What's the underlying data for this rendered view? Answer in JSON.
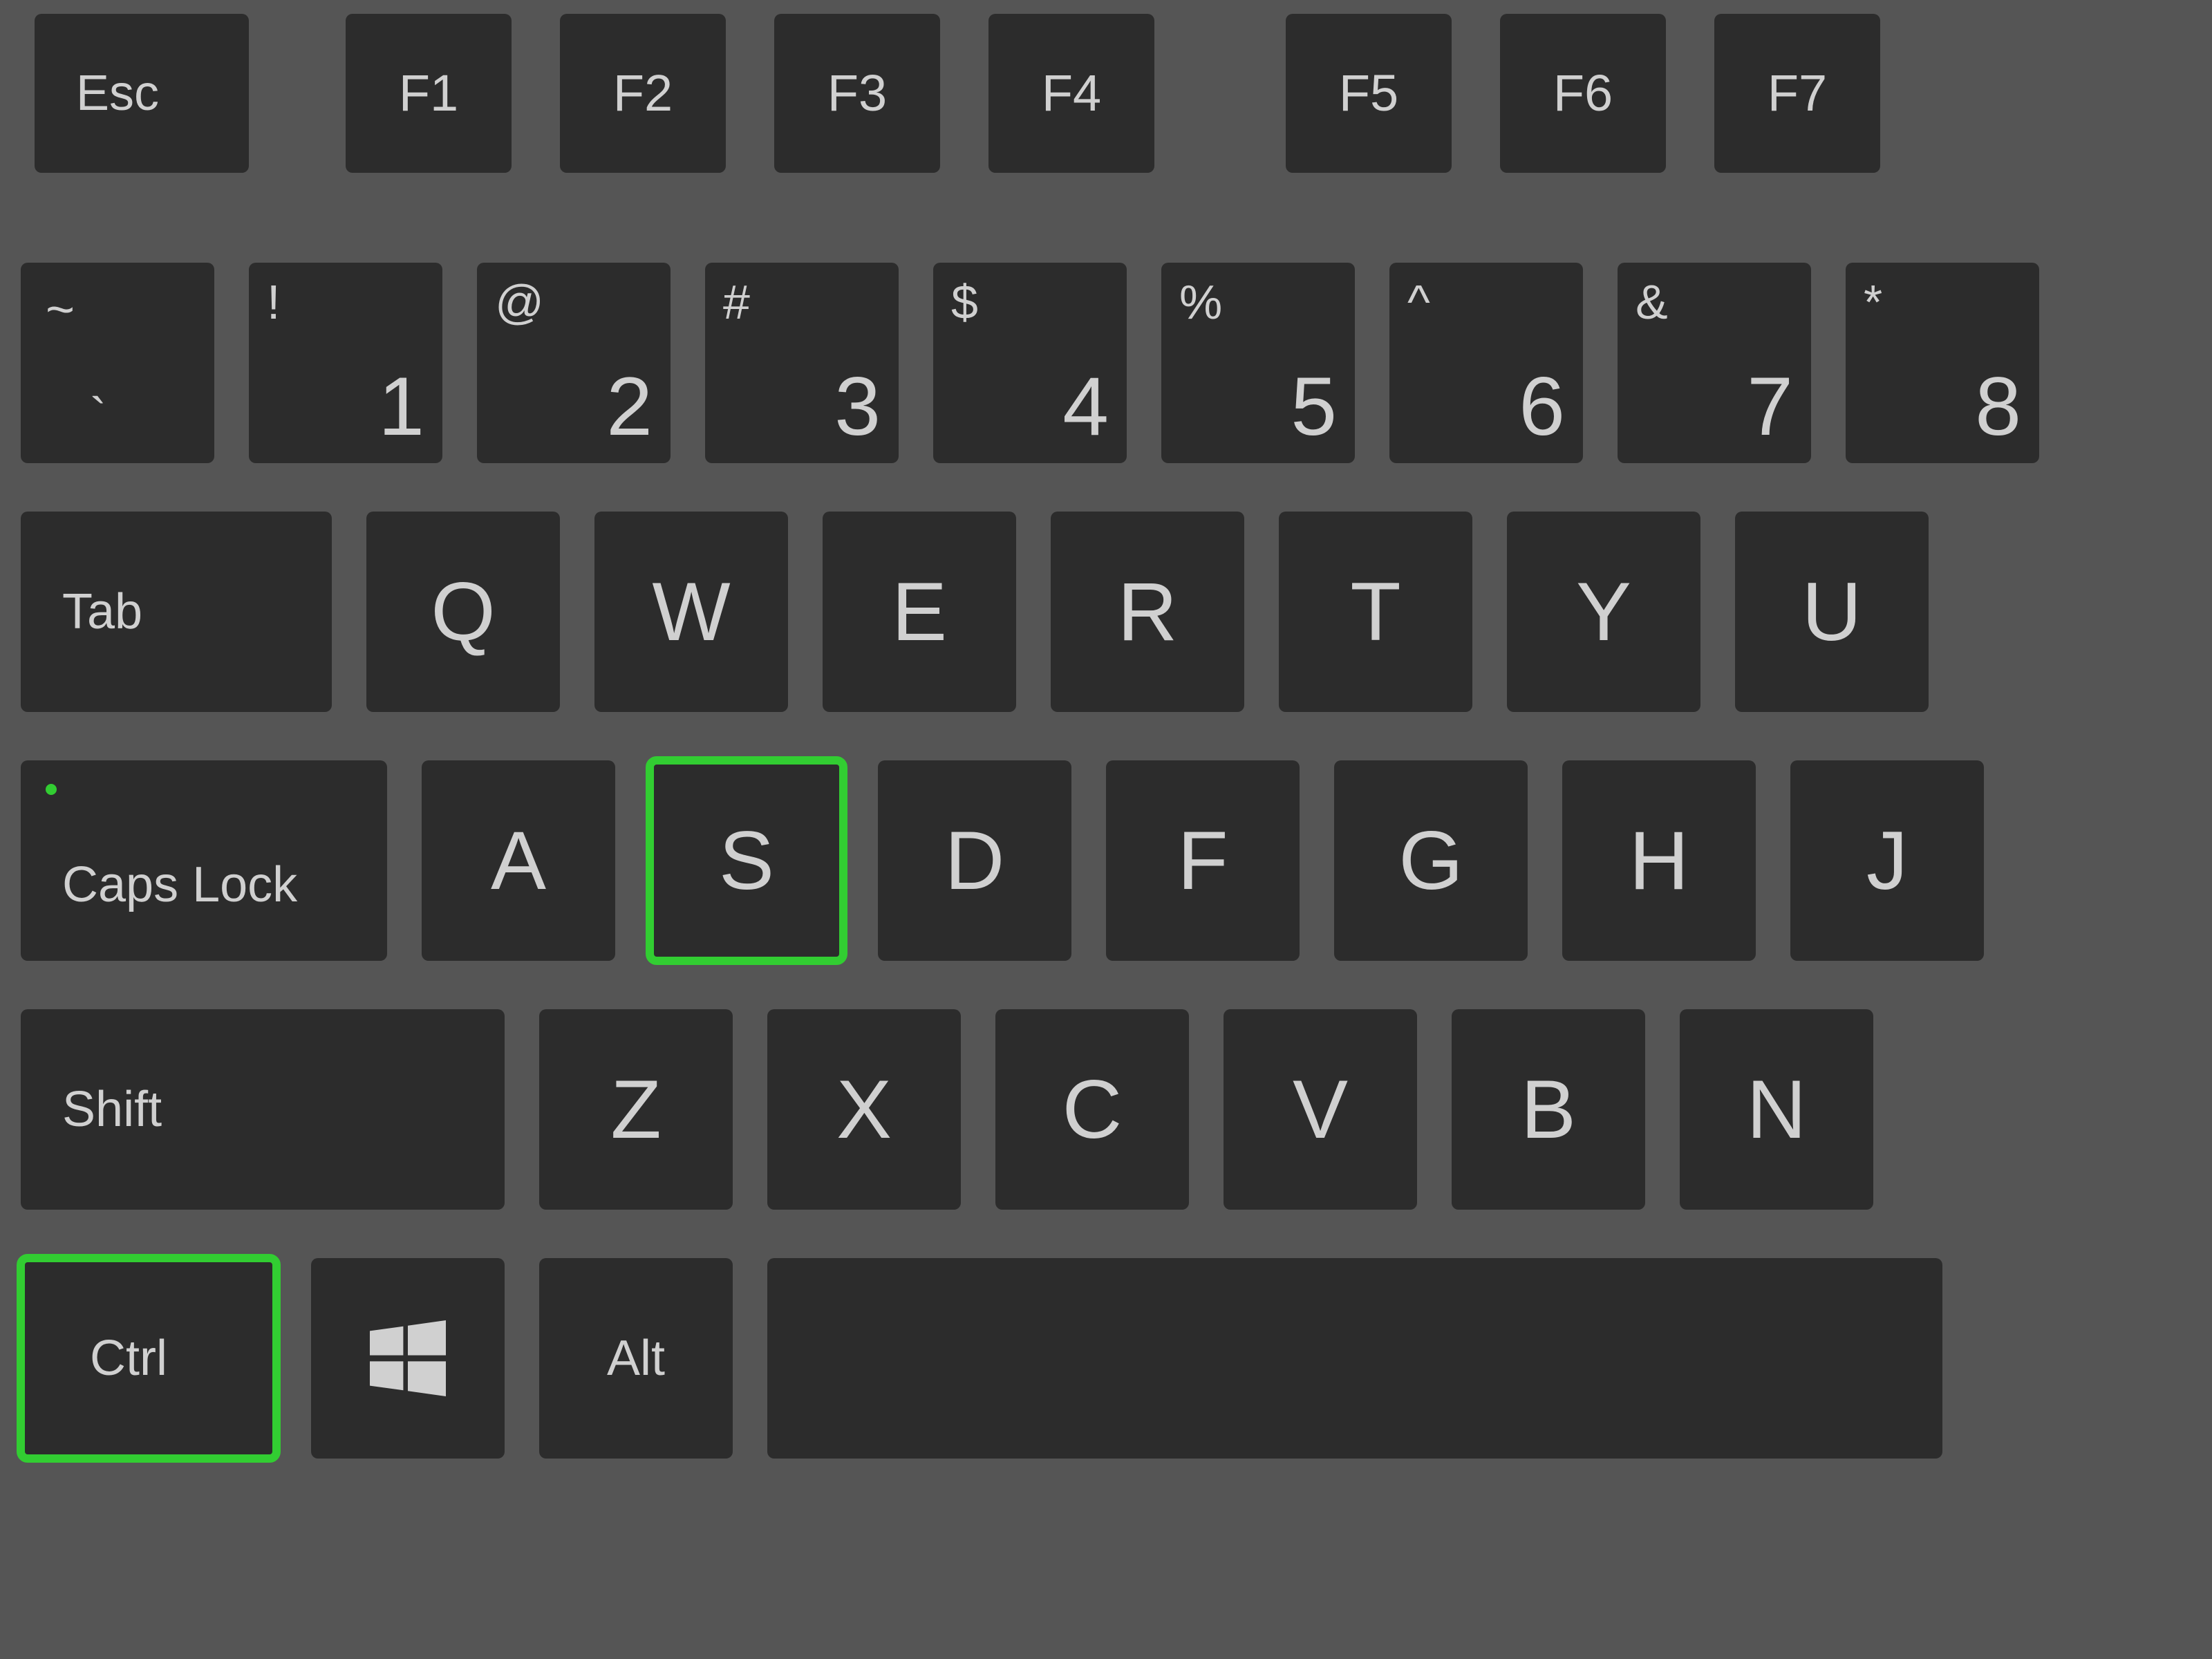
{
  "highlight_color": "#32cd32",
  "highlighted_keys": [
    "key-s",
    "key-ctrl"
  ],
  "rows": {
    "function": {
      "esc": "Esc",
      "f1": "F1",
      "f2": "F2",
      "f3": "F3",
      "f4": "F4",
      "f5": "F5",
      "f6": "F6",
      "f7": "F7"
    },
    "number": {
      "tilde_upper": "~",
      "tilde_lower": "`",
      "1": {
        "upper": "!",
        "lower": "1"
      },
      "2": {
        "upper": "@",
        "lower": "2"
      },
      "3": {
        "upper": "#",
        "lower": "3"
      },
      "4": {
        "upper": "$",
        "lower": "4"
      },
      "5": {
        "upper": "%",
        "lower": "5"
      },
      "6": {
        "upper": "^",
        "lower": "6"
      },
      "7": {
        "upper": "&",
        "lower": "7"
      },
      "8": {
        "upper": "*",
        "lower": "8"
      }
    },
    "qwerty": {
      "tab": "Tab",
      "q": "Q",
      "w": "W",
      "e": "E",
      "r": "R",
      "t": "T",
      "y": "Y",
      "u": "U"
    },
    "home": {
      "caps": "Caps Lock",
      "a": "A",
      "s": "S",
      "d": "D",
      "f": "F",
      "g": "G",
      "h": "H",
      "j": "J"
    },
    "shift": {
      "shift": "Shift",
      "z": "Z",
      "x": "X",
      "c": "C",
      "v": "V",
      "b": "B",
      "n": "N"
    },
    "bottom": {
      "ctrl": "Ctrl",
      "win": "windows-logo-icon",
      "alt": "Alt"
    }
  }
}
